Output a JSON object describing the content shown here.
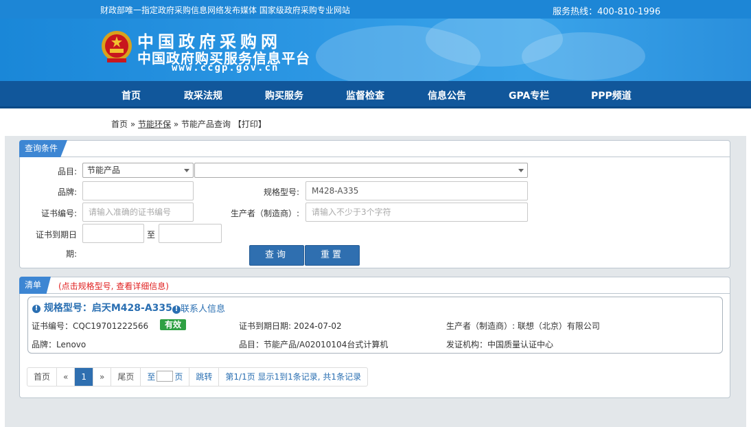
{
  "topbar": {
    "slogan": "财政部唯一指定政府采购信息网络发布媒体 国家级政府采购专业网站",
    "hotline": "服务热线：400-810-1996"
  },
  "banner": {
    "title": "中国政府采购网",
    "subtitle": "中国政府购买服务信息平台",
    "url": "www.ccgp.gov.cn"
  },
  "nav": {
    "items": [
      {
        "label": "首页"
      },
      {
        "label": "政采法规"
      },
      {
        "label": "购买服务"
      },
      {
        "label": "监督检查"
      },
      {
        "label": "信息公告"
      },
      {
        "label": "GPA专栏"
      },
      {
        "label": "PPP频道"
      }
    ]
  },
  "breadcrumb": {
    "home": "首页",
    "sep1": "»",
    "category": "节能环保",
    "sep2": "»",
    "current": "节能产品查询",
    "print": "【打印】"
  },
  "query": {
    "panel_title": "查询条件",
    "category_label": "品目:",
    "category_value": "节能产品",
    "subcategory_value": "",
    "brand_label": "品牌:",
    "brand_value": "",
    "model_label": "规格型号:",
    "model_value": "M428-A335",
    "cert_label": "证书编号:",
    "cert_placeholder": "请输入准确的证书编号",
    "maker_label": "生产者（制造商）:",
    "maker_placeholder": "请输入不少于3个字符",
    "expiry_label_1": "证书到期日",
    "expiry_label_2": "期:",
    "expiry_to": "至",
    "search_button": "查询",
    "reset_button": "重置"
  },
  "results": {
    "panel_title": "清单",
    "note": "(点击规格型号, 查看详细信息)",
    "items": [
      {
        "title": "规格型号：启天M428-A335",
        "contact": "联系人信息",
        "cert_no": "证书编号：CQC19701222566",
        "status": "有效",
        "expiry": "证书到期日期: 2024-07-02",
        "maker": "生产者（制造商）: 联想（北京）有限公司",
        "brand": "品牌：Lenovo",
        "category": "品目：节能产品/A02010104台式计算机",
        "issuer": "发证机构：中国质量认证中心"
      }
    ]
  },
  "pager": {
    "first": "首页",
    "prev": "«",
    "current": "1",
    "next": "»",
    "last": "尾页",
    "goto_prefix": "至",
    "goto_suffix": "页",
    "jump": "跳转",
    "summary": "第1/1页  显示1到1条记录, 共1条记录"
  },
  "colors": {
    "topbar": "#1d86d6",
    "nav": "#11579b",
    "accent": "#2f6fb0",
    "valid_badge": "#2ea043",
    "note_red": "#e02020"
  }
}
